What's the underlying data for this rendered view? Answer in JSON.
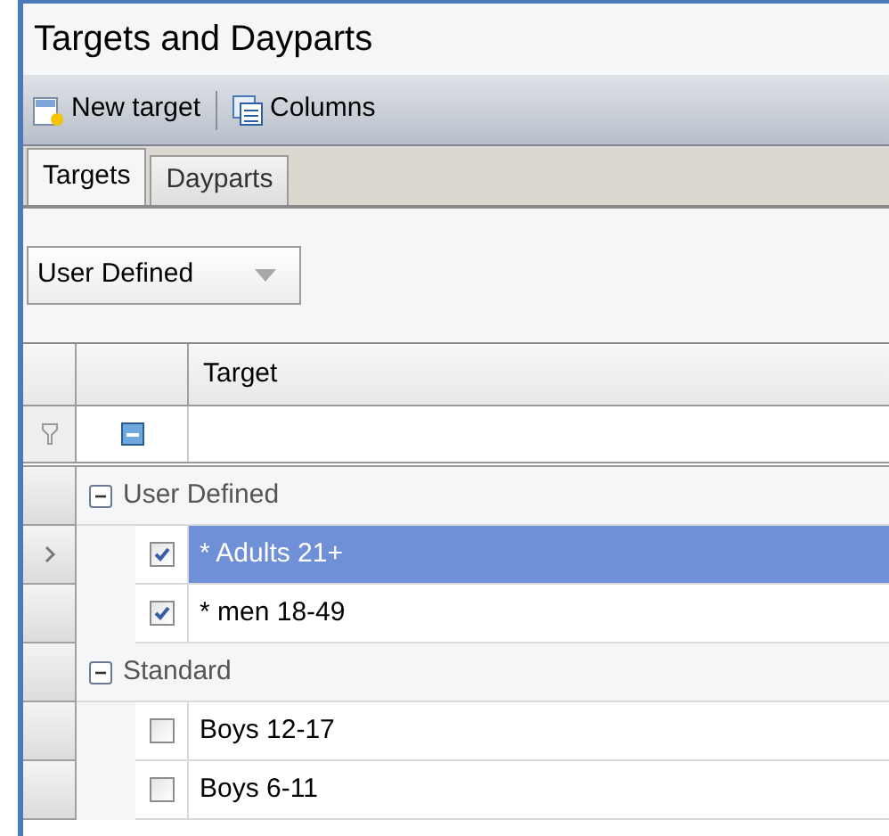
{
  "window": {
    "title": "Targets and Dayparts"
  },
  "toolbar": [
    {
      "kind": "new",
      "label": "New target"
    },
    {
      "kind": "columns",
      "label": "Columns"
    }
  ],
  "tabs": [
    {
      "label": "Targets",
      "selected": true
    },
    {
      "label": "Dayparts",
      "selected": false
    }
  ],
  "filter_dropdown": {
    "value": "User Defined"
  },
  "table": {
    "columns": [
      "Target"
    ],
    "groups": [
      {
        "label": "User Defined",
        "expanded": true,
        "rows": [
          {
            "name": "* Adults 21+",
            "checked": true,
            "selected": true
          },
          {
            "name": "* men 18-49",
            "checked": true,
            "selected": false
          }
        ]
      },
      {
        "label": "Standard",
        "expanded": true,
        "rows": [
          {
            "name": "Boys 12-17",
            "checked": false,
            "selected": false
          },
          {
            "name": "Boys 6-11",
            "checked": false,
            "selected": false
          }
        ]
      }
    ]
  }
}
